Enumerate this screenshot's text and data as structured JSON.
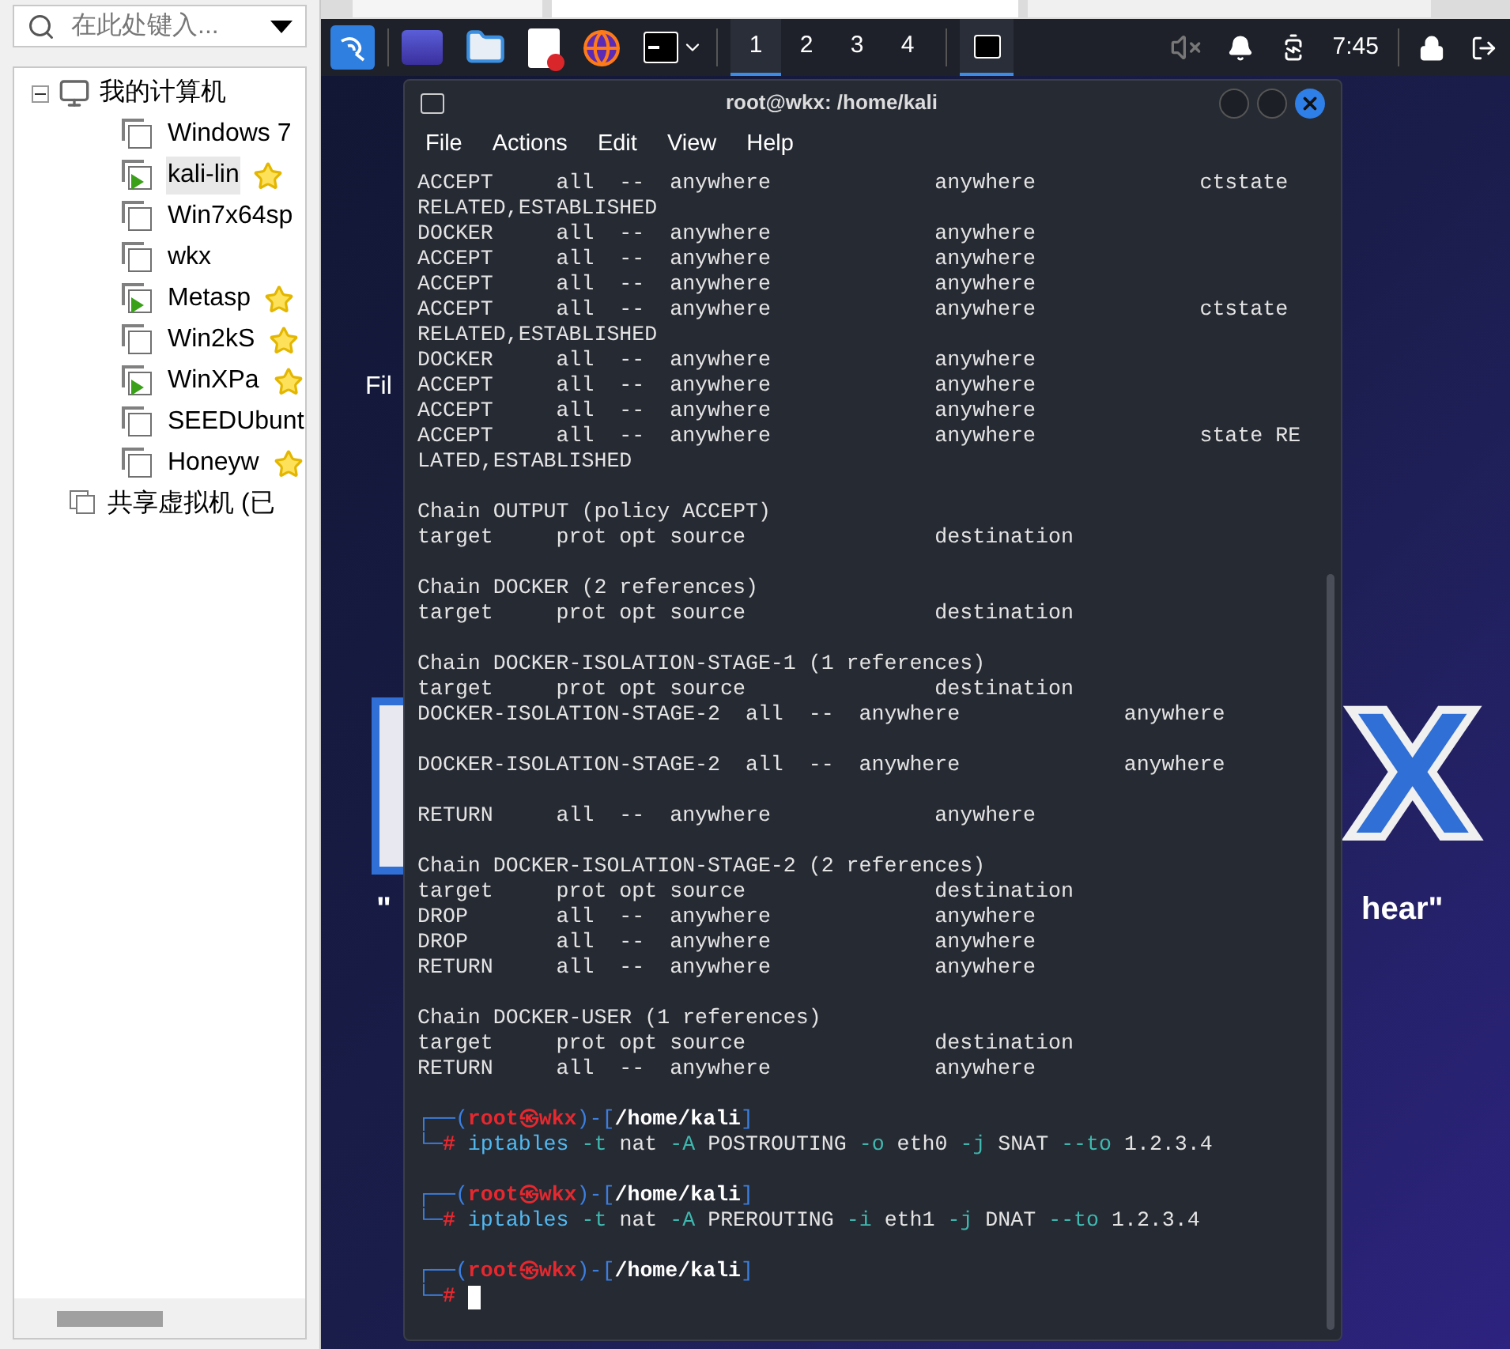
{
  "library": {
    "search": {
      "placeholder": "在此处键入..."
    },
    "tree": [
      {
        "name": "我的计算机",
        "kind": "computer",
        "expanded": true,
        "children": [
          {
            "name": "Windows 7",
            "running": false,
            "starred": false,
            "selected": false
          },
          {
            "name": "kali-lin",
            "running": true,
            "starred": true,
            "selected": true
          },
          {
            "name": "Win7x64sp",
            "running": false,
            "starred": false,
            "selected": false
          },
          {
            "name": "wkx",
            "running": false,
            "starred": false,
            "selected": false
          },
          {
            "name": "Metasp",
            "running": true,
            "starred": true,
            "selected": false
          },
          {
            "name": "Win2kS",
            "running": false,
            "starred": true,
            "selected": false
          },
          {
            "name": "WinXPa",
            "running": true,
            "starred": true,
            "selected": false
          },
          {
            "name": "SEEDUbunt",
            "running": false,
            "starred": false,
            "selected": false
          },
          {
            "name": "Honeyw",
            "running": false,
            "starred": true,
            "selected": false
          }
        ]
      },
      {
        "name": "共享虚拟机 (已",
        "kind": "shared"
      }
    ]
  },
  "panel": {
    "launchers": [
      {
        "kind": "desktop"
      },
      {
        "kind": "files"
      },
      {
        "kind": "editor"
      },
      {
        "kind": "browser"
      },
      {
        "kind": "terminal"
      }
    ],
    "workspaces": [
      {
        "label": "1",
        "selected": true
      },
      {
        "label": "2",
        "selected": false
      },
      {
        "label": "3",
        "selected": false
      },
      {
        "label": "4",
        "selected": false
      }
    ],
    "tasks": [
      {
        "selected": true
      }
    ],
    "tray": {
      "muted": true,
      "time": "7:45"
    }
  },
  "desktop": {
    "icon_label": "Fil",
    "logo_letter": "X",
    "quote_open": "\"",
    "quote_end": "hear\""
  },
  "terminal": {
    "title": "root@wkx: /home/kali",
    "menu": [
      "File",
      "Actions",
      "Edit",
      "View",
      "Help"
    ],
    "lines": [
      {
        "kind": "text",
        "text": "ACCEPT     all  --  anywhere             anywhere             ctstate"
      },
      {
        "kind": "text",
        "text": "RELATED,ESTABLISHED"
      },
      {
        "kind": "text",
        "text": "DOCKER     all  --  anywhere             anywhere"
      },
      {
        "kind": "text",
        "text": "ACCEPT     all  --  anywhere             anywhere"
      },
      {
        "kind": "text",
        "text": "ACCEPT     all  --  anywhere             anywhere"
      },
      {
        "kind": "text",
        "text": "ACCEPT     all  --  anywhere             anywhere             ctstate"
      },
      {
        "kind": "text",
        "text": "RELATED,ESTABLISHED"
      },
      {
        "kind": "text",
        "text": "DOCKER     all  --  anywhere             anywhere"
      },
      {
        "kind": "text",
        "text": "ACCEPT     all  --  anywhere             anywhere"
      },
      {
        "kind": "text",
        "text": "ACCEPT     all  --  anywhere             anywhere"
      },
      {
        "kind": "text",
        "text": "ACCEPT     all  --  anywhere             anywhere             state RE"
      },
      {
        "kind": "text",
        "text": "LATED,ESTABLISHED"
      },
      {
        "kind": "blank"
      },
      {
        "kind": "text",
        "text": "Chain OUTPUT (policy ACCEPT)"
      },
      {
        "kind": "text",
        "text": "target     prot opt source               destination"
      },
      {
        "kind": "blank"
      },
      {
        "kind": "text",
        "text": "Chain DOCKER (2 references)"
      },
      {
        "kind": "text",
        "text": "target     prot opt source               destination"
      },
      {
        "kind": "blank"
      },
      {
        "kind": "text",
        "text": "Chain DOCKER-ISOLATION-STAGE-1 (1 references)"
      },
      {
        "kind": "text",
        "text": "target     prot opt source               destination"
      },
      {
        "kind": "text",
        "text": "DOCKER-ISOLATION-STAGE-2  all  --  anywhere             anywhere"
      },
      {
        "kind": "blank"
      },
      {
        "kind": "text",
        "text": "DOCKER-ISOLATION-STAGE-2  all  --  anywhere             anywhere"
      },
      {
        "kind": "blank"
      },
      {
        "kind": "text",
        "text": "RETURN     all  --  anywhere             anywhere"
      },
      {
        "kind": "blank"
      },
      {
        "kind": "text",
        "text": "Chain DOCKER-ISOLATION-STAGE-2 (2 references)"
      },
      {
        "kind": "text",
        "text": "target     prot opt source               destination"
      },
      {
        "kind": "text",
        "text": "DROP       all  --  anywhere             anywhere"
      },
      {
        "kind": "text",
        "text": "DROP       all  --  anywhere             anywhere"
      },
      {
        "kind": "text",
        "text": "RETURN     all  --  anywhere             anywhere"
      },
      {
        "kind": "blank"
      },
      {
        "kind": "text",
        "text": "Chain DOCKER-USER (1 references)"
      },
      {
        "kind": "text",
        "text": "target     prot opt source               destination"
      },
      {
        "kind": "text",
        "text": "RETURN     all  --  anywhere             anywhere"
      },
      {
        "kind": "blank"
      },
      {
        "kind": "prompt",
        "open": "┌──(",
        "user_host": "root㉿wkx",
        "mid": ")-[",
        "path": "/home/kali",
        "close": "]"
      },
      {
        "kind": "command",
        "lead": "└─",
        "sign": "#",
        "tokens": [
          {
            "kind": "program",
            "text": "iptables"
          },
          {
            "kind": "option",
            "text": "-t"
          },
          {
            "kind": "arg",
            "text": "nat"
          },
          {
            "kind": "option",
            "text": "-A"
          },
          {
            "kind": "arg",
            "text": "POSTROUTING"
          },
          {
            "kind": "option",
            "text": "-o"
          },
          {
            "kind": "arg",
            "text": "eth0"
          },
          {
            "kind": "option",
            "text": "-j"
          },
          {
            "kind": "arg",
            "text": "SNAT"
          },
          {
            "kind": "option",
            "text": "--to"
          },
          {
            "kind": "arg",
            "text": "1.2.3.4"
          }
        ]
      },
      {
        "kind": "blank"
      },
      {
        "kind": "prompt",
        "open": "┌──(",
        "user_host": "root㉿wkx",
        "mid": ")-[",
        "path": "/home/kali",
        "close": "]"
      },
      {
        "kind": "command",
        "lead": "└─",
        "sign": "#",
        "tokens": [
          {
            "kind": "program",
            "text": "iptables"
          },
          {
            "kind": "option",
            "text": "-t"
          },
          {
            "kind": "arg",
            "text": "nat"
          },
          {
            "kind": "option",
            "text": "-A"
          },
          {
            "kind": "arg",
            "text": "PREROUTING"
          },
          {
            "kind": "option",
            "text": "-i"
          },
          {
            "kind": "arg",
            "text": "eth1"
          },
          {
            "kind": "option",
            "text": "-j"
          },
          {
            "kind": "arg",
            "text": "DNAT"
          },
          {
            "kind": "option",
            "text": "--to"
          },
          {
            "kind": "arg",
            "text": "1.2.3.4"
          }
        ]
      },
      {
        "kind": "blank"
      },
      {
        "kind": "prompt",
        "open": "┌──(",
        "user_host": "root㉿wkx",
        "mid": ")-[",
        "path": "/home/kali",
        "close": "]"
      },
      {
        "kind": "command",
        "lead": "└─",
        "sign": "#",
        "cursor": true
      }
    ]
  }
}
